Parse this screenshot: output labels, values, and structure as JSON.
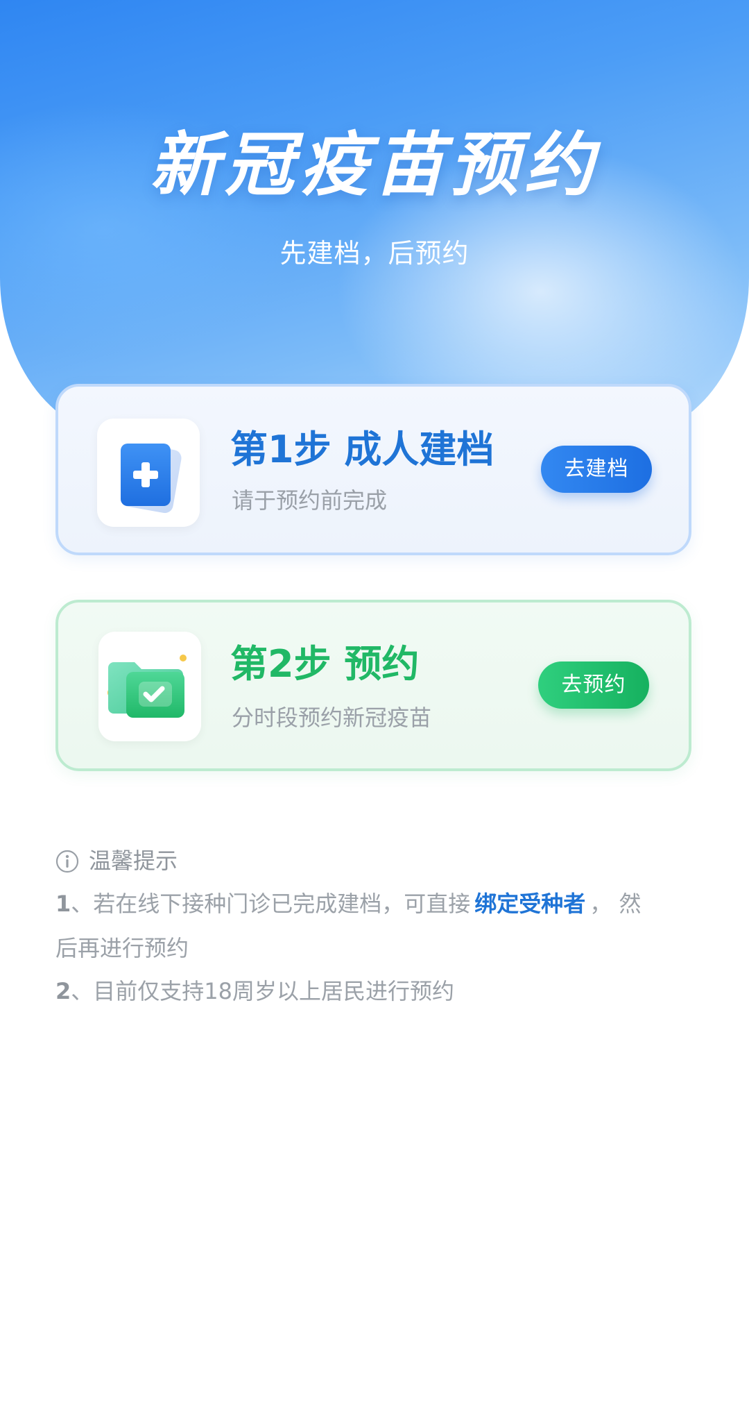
{
  "header": {
    "title": "新冠疫苗预约",
    "subtitle": "先建档，后预约"
  },
  "steps": [
    {
      "title": "第1步 成人建档",
      "description": "请于预约前完成",
      "button_label": "去建档",
      "icon": "add-document-icon",
      "accent_color": "#1f74d6"
    },
    {
      "title": "第2步 预约",
      "description": "分时段预约新冠疫苗",
      "button_label": "去预约",
      "icon": "folder-check-icon",
      "accent_color": "#21b866"
    }
  ],
  "tips": {
    "title": "温馨提示",
    "icon": "info-icon",
    "items": [
      {
        "number": "1",
        "text_before": "、若在线下接种门诊已完成建档，可直接",
        "link_text": "绑定受种者",
        "text_after": "，  然",
        "continuation": "后再进行预约"
      },
      {
        "number": "2",
        "text": "、目前仅支持18周岁以上居民进行预约"
      }
    ]
  },
  "colors": {
    "hero_blue": "#2f86f2",
    "link_blue": "#1f74d6",
    "green": "#21b866",
    "muted_text": "#9ba1a8"
  }
}
